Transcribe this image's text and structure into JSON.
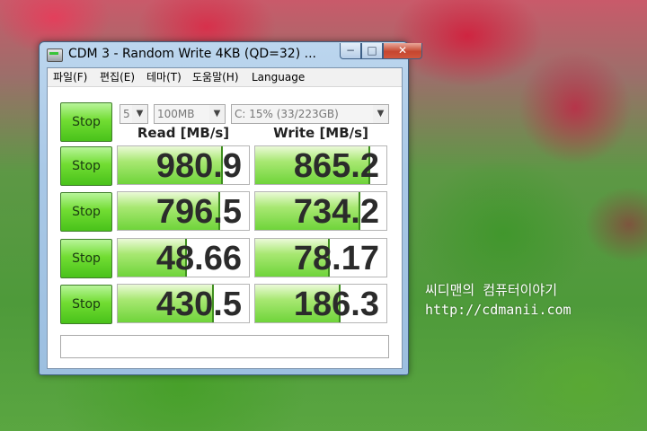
{
  "window": {
    "title": "CDM 3 - Random Write 4KB (QD=32) ...",
    "controls": {
      "minimize": "−",
      "maximize": "□",
      "close": "✕"
    }
  },
  "menu": [
    "파일(F)",
    "편집(E)",
    "테마(T)",
    "도움말(H)",
    "Language"
  ],
  "toolbar": {
    "stop_label": "Stop",
    "count": "5",
    "size": "100MB",
    "drive": "C: 15% (33/223GB)"
  },
  "columns": {
    "read": "Read [MB/s]",
    "write": "Write [MB/s]"
  },
  "rows": [
    {
      "stop_label": "Stop",
      "read": "980.9",
      "write": "865.2",
      "read_fill": 0.8,
      "write_fill": 0.88
    },
    {
      "stop_label": "Stop",
      "read": "796.5",
      "write": "734.2",
      "read_fill": 0.78,
      "write_fill": 0.8
    },
    {
      "stop_label": "Stop",
      "read": "48.66",
      "write": "78.17",
      "read_fill": 0.53,
      "write_fill": 0.57
    },
    {
      "stop_label": "Stop",
      "read": "430.5",
      "write": "186.3",
      "read_fill": 0.73,
      "write_fill": 0.65
    }
  ],
  "status_text": "",
  "watermark": {
    "line1": "씨디맨의 컴퓨터이야기",
    "line2": "http://cdmanii.com"
  }
}
